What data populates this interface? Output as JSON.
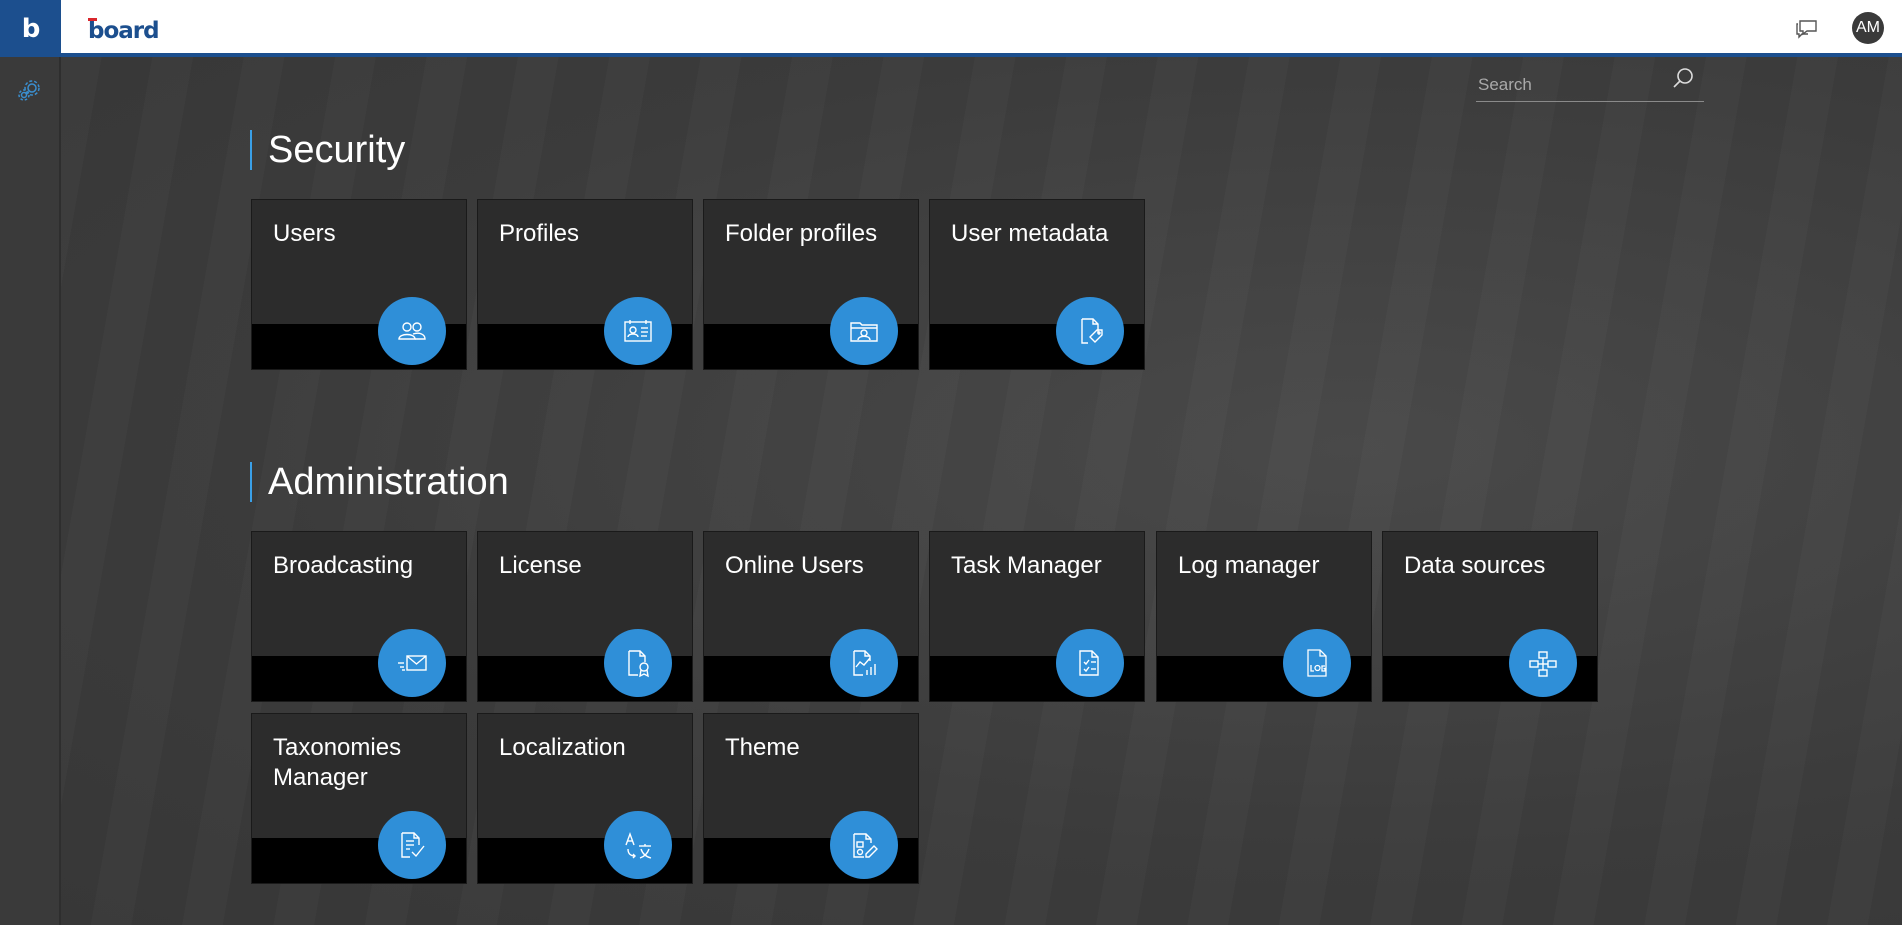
{
  "header": {
    "brand_letter": "b",
    "logo_text": "board",
    "avatar_initials": "AM"
  },
  "search": {
    "placeholder": "Search"
  },
  "sections": [
    {
      "title": "Security",
      "tiles": [
        {
          "label": "Users",
          "icon": "users-icon"
        },
        {
          "label": "Profiles",
          "icon": "profile-card-icon"
        },
        {
          "label": "Folder profiles",
          "icon": "folder-user-icon"
        },
        {
          "label": "User metadata",
          "icon": "document-tag-icon"
        }
      ]
    },
    {
      "title": "Administration",
      "tiles": [
        {
          "label": "Broadcasting",
          "icon": "envelope-send-icon"
        },
        {
          "label": "License",
          "icon": "certificate-icon"
        },
        {
          "label": "Online Users",
          "icon": "chart-document-icon"
        },
        {
          "label": "Task Manager",
          "icon": "checklist-icon"
        },
        {
          "label": "Log manager",
          "icon": "log-file-icon"
        },
        {
          "label": "Data sources",
          "icon": "hierarchy-icon"
        },
        {
          "label": "Taxonomies Manager",
          "icon": "document-check-icon"
        },
        {
          "label": "Localization",
          "icon": "translate-icon"
        },
        {
          "label": "Theme",
          "icon": "theme-edit-icon"
        }
      ]
    }
  ],
  "colors": {
    "brand": "#1c4f8e",
    "accent": "#2f8fd8",
    "tile": "#2c2c2c",
    "background": "#3e3e3e"
  }
}
